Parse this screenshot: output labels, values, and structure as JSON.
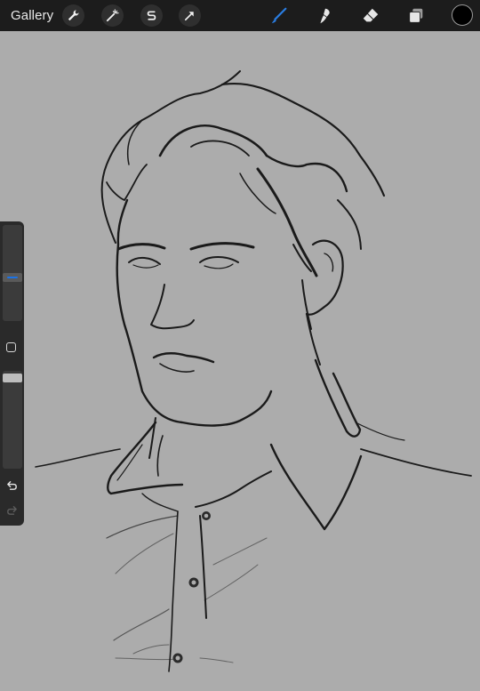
{
  "app": {
    "gallery_label": "Gallery"
  },
  "toolbar": {
    "left_tools": [
      "wrench-icon",
      "magic-wand-icon",
      "selection-s-icon",
      "transform-arrow-icon"
    ],
    "right_tools": [
      "brush-icon",
      "smudge-icon",
      "eraser-icon",
      "layers-icon"
    ],
    "active_tool": "brush-icon",
    "current_color": "#000000"
  },
  "sidebar": {
    "brush_size": 0.45,
    "brush_opacity": 0.97,
    "size_thumb_color": "#1a73e8",
    "controls": [
      "modify-square-button",
      "undo-button",
      "redo-button"
    ]
  },
  "colors": {
    "canvas": "#acacac",
    "toolbar": "#1c1c1c",
    "accent": "#2a7de1"
  }
}
